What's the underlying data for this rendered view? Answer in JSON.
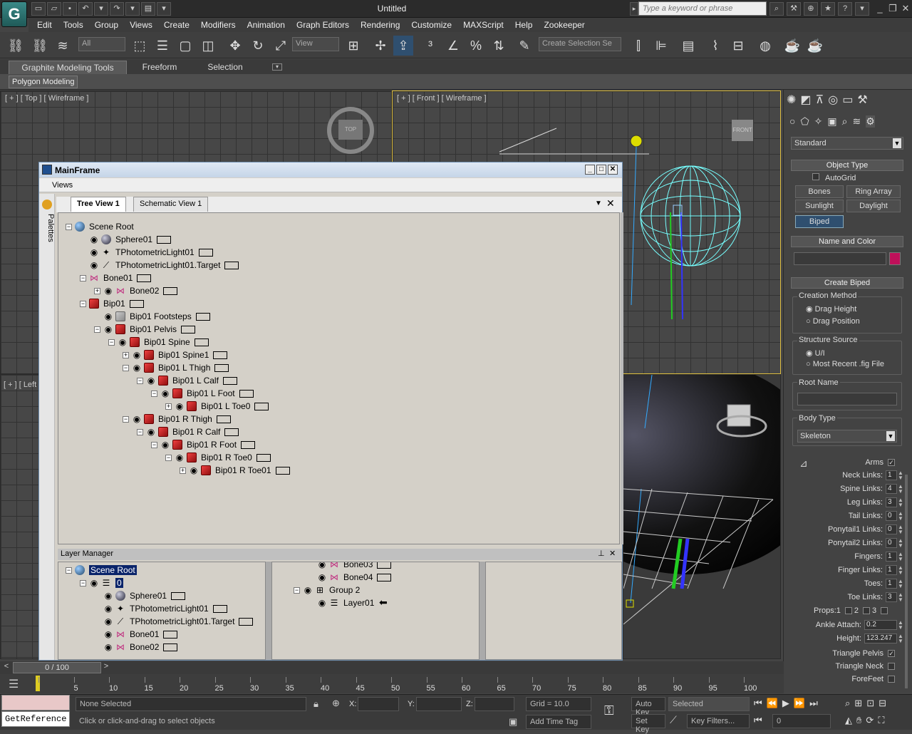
{
  "app": {
    "title": "Untitled",
    "search_placeholder": "Type a keyword or phrase",
    "logo": "G"
  },
  "menus": [
    "Edit",
    "Tools",
    "Group",
    "Views",
    "Create",
    "Modifiers",
    "Animation",
    "Graph Editors",
    "Rendering",
    "Customize",
    "MAXScript",
    "Help",
    "Zookeeper"
  ],
  "toolbar": {
    "filter_value": "All",
    "refcoord_value": "View",
    "named_selection": "Create Selection Se"
  },
  "ribbon": {
    "tabs": [
      "Graphite Modeling Tools",
      "Freeform",
      "Selection"
    ],
    "panel_button": "Polygon Modeling"
  },
  "viewports": {
    "top": {
      "label": "[ + ] [ Top ] [ Wireframe ]",
      "cube": "TOP"
    },
    "front": {
      "label": "[ + ] [ Front ] [ Wireframe ]",
      "cube": "FRONT"
    },
    "left": {
      "label": "[ + ] [ Left"
    }
  },
  "mainframe": {
    "title": "MainFrame",
    "menu": "Views",
    "palettes_label": "Palettes",
    "tabs": [
      "Tree View 1",
      "Schematic View 1"
    ],
    "tree": [
      {
        "label": "Scene Root",
        "depth": 0,
        "icon": "scene-icon",
        "expander": "-",
        "eye": false,
        "swatch": false
      },
      {
        "label": "Sphere01",
        "depth": 1,
        "icon": "sphere-icon",
        "expander": "",
        "eye": true,
        "swatch": true
      },
      {
        "label": "TPhotometricLight01",
        "depth": 1,
        "icon": "light-icon",
        "expander": "",
        "eye": true,
        "swatch": true
      },
      {
        "label": "TPhotometricLight01.Target",
        "depth": 1,
        "icon": "target-icon",
        "expander": "",
        "eye": true,
        "swatch": true
      },
      {
        "label": "Bone01",
        "depth": 1,
        "icon": "bone-icon",
        "expander": "-",
        "eye": false,
        "swatch": true
      },
      {
        "label": "Bone02",
        "depth": 2,
        "icon": "bone-icon",
        "expander": "+",
        "eye": true,
        "swatch": true
      },
      {
        "label": "Bip01",
        "depth": 1,
        "icon": "biped-icon",
        "expander": "-",
        "eye": false,
        "swatch": true
      },
      {
        "label": "Bip01 Footsteps",
        "depth": 2,
        "icon": "footsteps-icon",
        "expander": "",
        "eye": true,
        "swatch": true
      },
      {
        "label": "Bip01 Pelvis",
        "depth": 2,
        "icon": "biped-icon",
        "expander": "-",
        "eye": true,
        "swatch": true
      },
      {
        "label": "Bip01 Spine",
        "depth": 3,
        "icon": "biped-icon",
        "expander": "-",
        "eye": true,
        "swatch": true
      },
      {
        "label": "Bip01 Spine1",
        "depth": 4,
        "icon": "biped-icon",
        "expander": "+",
        "eye": true,
        "swatch": true
      },
      {
        "label": "Bip01 L Thigh",
        "depth": 4,
        "icon": "biped-icon",
        "expander": "-",
        "eye": true,
        "swatch": true
      },
      {
        "label": "Bip01 L Calf",
        "depth": 5,
        "icon": "biped-icon",
        "expander": "-",
        "eye": true,
        "swatch": true
      },
      {
        "label": "Bip01 L Foot",
        "depth": 6,
        "icon": "biped-icon",
        "expander": "-",
        "eye": true,
        "swatch": true
      },
      {
        "label": "Bip01 L Toe0",
        "depth": 7,
        "icon": "biped-icon",
        "expander": "+",
        "eye": true,
        "swatch": true
      },
      {
        "label": "Bip01 R Thigh",
        "depth": 4,
        "icon": "biped-icon",
        "expander": "-",
        "eye": true,
        "swatch": true
      },
      {
        "label": "Bip01 R Calf",
        "depth": 5,
        "icon": "biped-icon",
        "expander": "-",
        "eye": true,
        "swatch": true
      },
      {
        "label": "Bip01 R Foot",
        "depth": 6,
        "icon": "biped-icon",
        "expander": "-",
        "eye": true,
        "swatch": true
      },
      {
        "label": "Bip01 R Toe0",
        "depth": 7,
        "icon": "biped-icon",
        "expander": "-",
        "eye": true,
        "swatch": true
      },
      {
        "label": "Bip01 R Toe01",
        "depth": 8,
        "icon": "biped-icon",
        "expander": "+",
        "eye": true,
        "swatch": true
      }
    ]
  },
  "layer_manager": {
    "title": "Layer Manager",
    "left_tree": [
      {
        "label": "Scene Root",
        "depth": 0,
        "icon": "scene-icon",
        "expander": "-",
        "eye": false,
        "swatch": false,
        "selected": true
      },
      {
        "label": "0",
        "depth": 1,
        "icon": "layer-icon",
        "expander": "-",
        "eye": true,
        "swatch": false,
        "selected": true
      },
      {
        "label": "Sphere01",
        "depth": 2,
        "icon": "sphere-icon",
        "expander": "",
        "eye": true,
        "swatch": true,
        "selected": false
      },
      {
        "label": "TPhotometricLight01",
        "depth": 2,
        "icon": "light-icon",
        "expander": "",
        "eye": true,
        "swatch": true,
        "selected": false
      },
      {
        "label": "TPhotometricLight01.Target",
        "depth": 2,
        "icon": "target-icon",
        "expander": "",
        "eye": true,
        "swatch": true,
        "selected": false
      },
      {
        "label": "Bone01",
        "depth": 2,
        "icon": "bone-icon",
        "expander": "",
        "eye": true,
        "swatch": true,
        "selected": false
      },
      {
        "label": "Bone02",
        "depth": 2,
        "icon": "bone-icon",
        "expander": "",
        "eye": true,
        "swatch": true,
        "selected": false
      }
    ],
    "right_tree": [
      {
        "label": "Bone03",
        "depth": 1,
        "icon": "bone-icon",
        "expander": "",
        "eye": true,
        "swatch": true
      },
      {
        "label": "Bone04",
        "depth": 1,
        "icon": "bone-icon",
        "expander": "",
        "eye": true,
        "swatch": true
      },
      {
        "label": "Group 2",
        "depth": 0,
        "icon": "group-icon",
        "expander": "-",
        "eye": true,
        "swatch": false
      },
      {
        "label": "Layer01",
        "depth": 1,
        "icon": "layer-icon",
        "expander": "",
        "eye": true,
        "swatch": false
      }
    ]
  },
  "command_panel": {
    "category": "Standard",
    "object_type": {
      "title": "Object Type",
      "autogrid": "AutoGrid",
      "buttons": [
        "Bones",
        "Ring Array",
        "Sunlight",
        "Daylight",
        "Biped"
      ]
    },
    "name_color": {
      "title": "Name and Color",
      "name": "",
      "color": "#c0105a"
    },
    "create_biped": {
      "title": "Create Biped",
      "creation_method": "Creation Method",
      "methods": [
        "Drag Height",
        "Drag Position"
      ],
      "structure_source": "Structure Source",
      "sources": [
        "U/I",
        "Most Recent .fig File"
      ],
      "root_name_label": "Root Name",
      "root_name": "",
      "body_type_label": "Body Type",
      "body_type": "Skeleton",
      "arms": "Arms",
      "spinners": [
        {
          "label": "Neck Links:",
          "value": "1"
        },
        {
          "label": "Spine Links:",
          "value": "4"
        },
        {
          "label": "Leg Links:",
          "value": "3"
        },
        {
          "label": "Tail Links:",
          "value": "0"
        },
        {
          "label": "Ponytail1 Links:",
          "value": "0"
        },
        {
          "label": "Ponytail2 Links:",
          "value": "0"
        },
        {
          "label": "Fingers:",
          "value": "1"
        },
        {
          "label": "Finger Links:",
          "value": "1"
        },
        {
          "label": "Toes:",
          "value": "1"
        },
        {
          "label": "Toe Links:",
          "value": "3"
        }
      ],
      "props_label": "Props:",
      "props": [
        "1",
        "2",
        "3"
      ],
      "ankle_label": "Ankle Attach:",
      "ankle": "0.2",
      "height_label": "Height:",
      "height": "123.247",
      "triangle_pelvis": "Triangle Pelvis",
      "triangle_neck": "Triangle Neck",
      "forefeet": "ForeFeet"
    }
  },
  "timeline": {
    "slider": "0 / 100",
    "ticks": [
      "0",
      "5",
      "10",
      "15",
      "20",
      "25",
      "30",
      "35",
      "40",
      "45",
      "50",
      "55",
      "60",
      "65",
      "70",
      "75",
      "80",
      "85",
      "90",
      "95",
      "100"
    ]
  },
  "status": {
    "selection": "None Selected",
    "prompt": "Click or click-and-drag to select objects",
    "x_label": "X:",
    "y_label": "Y:",
    "z_label": "Z:",
    "grid": "Grid = 10.0",
    "add_time_tag": "Add Time Tag",
    "auto_key": "Auto Key",
    "selected": "Selected",
    "set_key": "Set Key",
    "key_filters": "Key Filters...",
    "frame": "0",
    "getreference": "GetReference"
  }
}
